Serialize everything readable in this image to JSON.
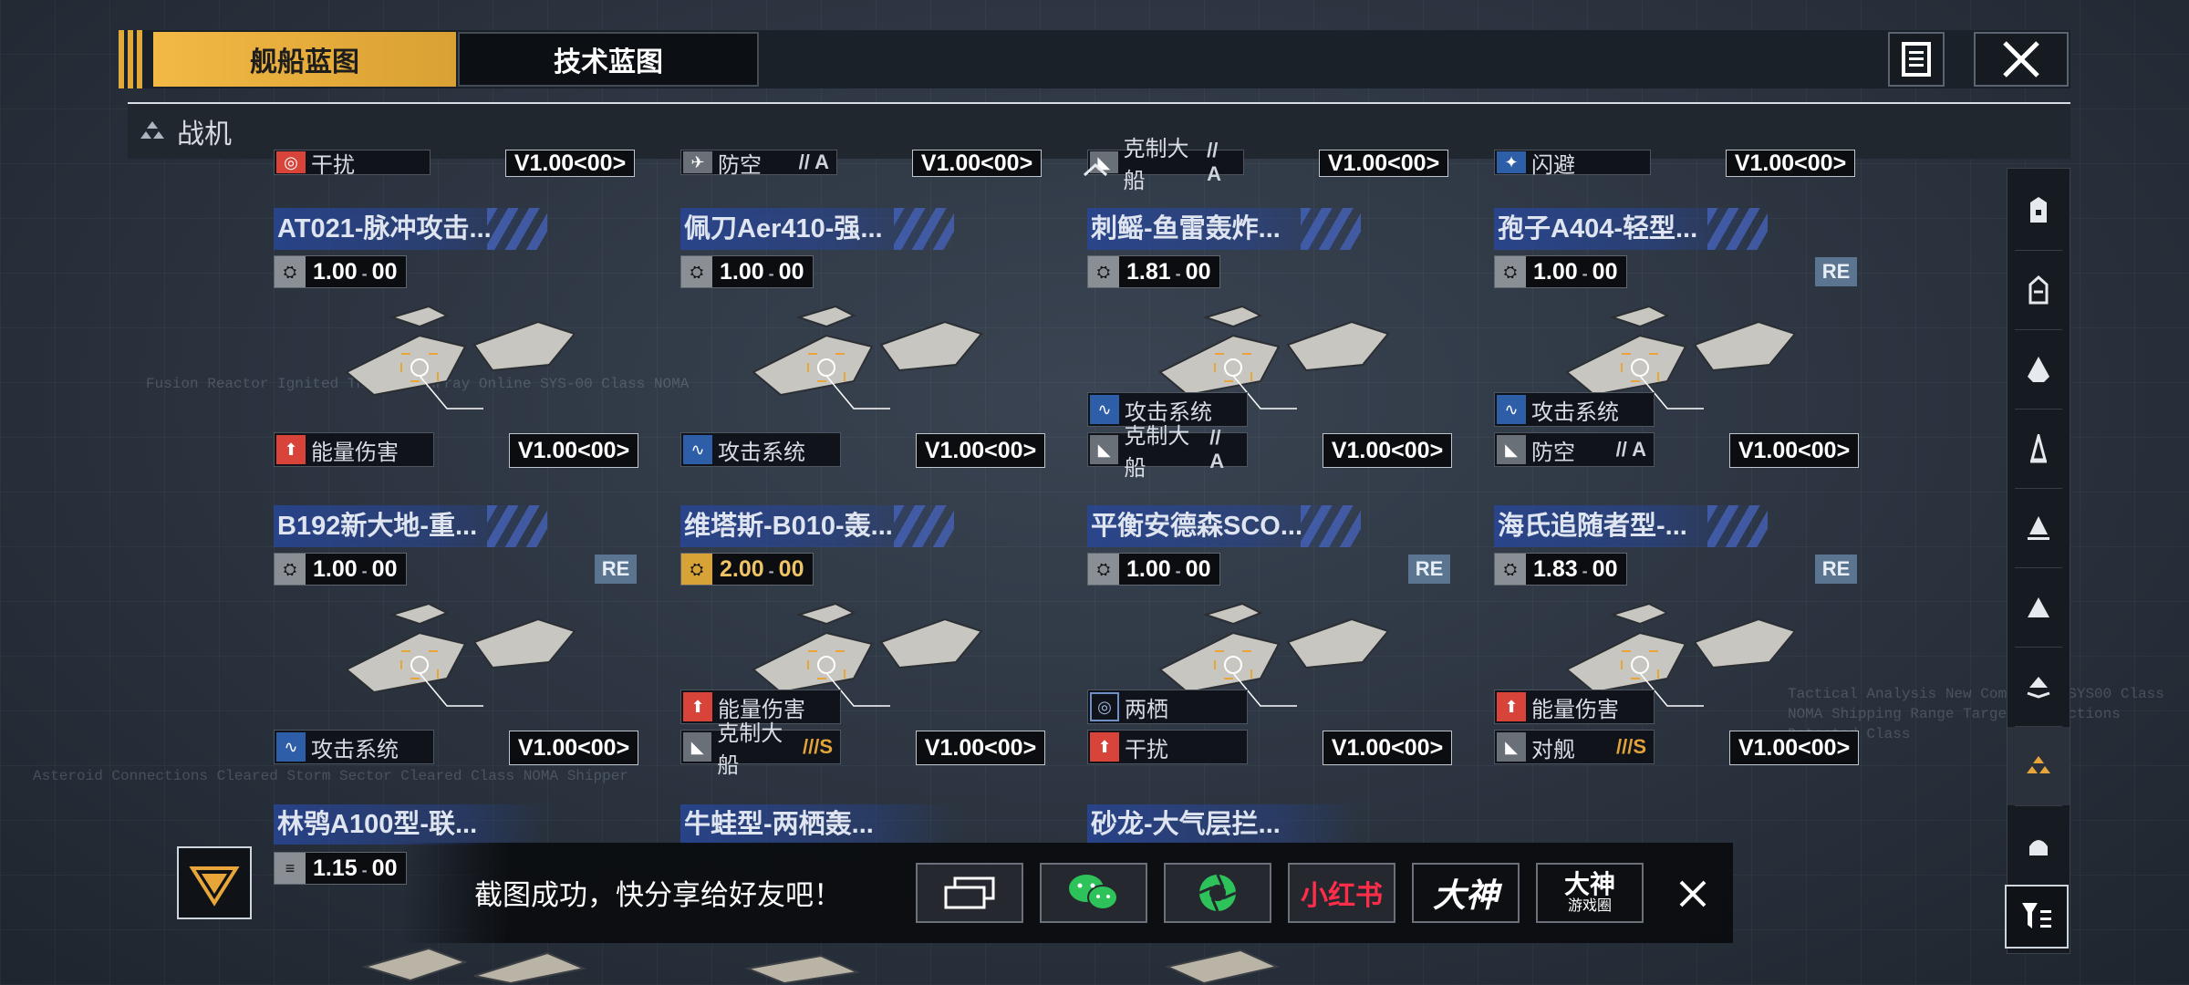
{
  "tabs": {
    "ship_blueprint": "舰船蓝图",
    "tech_blueprint": "技术蓝图"
  },
  "category": {
    "label": "战机"
  },
  "top_row_partial": [
    {
      "tag": "干扰",
      "version": "V1.00<00>"
    },
    {
      "tag": "防空",
      "rank": "// A",
      "version": "V1.00<00>"
    },
    {
      "tag": "克制大船",
      "rank": "// A",
      "version": "V1.00<00>"
    },
    {
      "tag": "闪避",
      "version": "V1.00<00>"
    }
  ],
  "cards": [
    {
      "title": "AT021-脉冲攻击...",
      "value": "1.00",
      "value_sub": "00",
      "re": false,
      "tags": [
        {
          "label": "能量伤害",
          "icon": "red"
        }
      ],
      "version": "V1.00<00>"
    },
    {
      "title": "佩刀Aer410-强...",
      "value": "1.00",
      "value_sub": "00",
      "re": false,
      "tags": [
        {
          "label": "攻击系统",
          "icon": "blue"
        }
      ],
      "version": "V1.00<00>"
    },
    {
      "title": "刺鳐-鱼雷轰炸...",
      "value": "1.81",
      "value_sub": "00",
      "re": false,
      "tags": [
        {
          "label": "攻击系统",
          "icon": "blue"
        },
        {
          "label": "克制大船",
          "icon": "grey",
          "rank": "// A"
        }
      ],
      "version": "V1.00<00>"
    },
    {
      "title": "孢子A404-轻型...",
      "value": "1.00",
      "value_sub": "00",
      "re": true,
      "re_label": "RE",
      "tags": [
        {
          "label": "攻击系统",
          "icon": "blue"
        },
        {
          "label": "防空",
          "icon": "grey",
          "rank": "// A"
        }
      ],
      "version": "V1.00<00>"
    },
    {
      "title": "B192新大地-重...",
      "value": "1.00",
      "value_sub": "00",
      "re": true,
      "re_label": "RE",
      "tags": [
        {
          "label": "攻击系统",
          "icon": "blue"
        }
      ],
      "version": "V1.00<00>"
    },
    {
      "title": "维塔斯-B010-轰...",
      "value": "2.00",
      "value_sub": "00",
      "gold": true,
      "re": false,
      "tags": [
        {
          "label": "能量伤害",
          "icon": "red"
        },
        {
          "label": "克制大船",
          "icon": "grey",
          "rank": "///S",
          "rank_gold": true
        }
      ],
      "version": "V1.00<00>"
    },
    {
      "title": "平衡安德森SCO...",
      "value": "1.00",
      "value_sub": "00",
      "re": true,
      "re_label": "RE",
      "tags": [
        {
          "label": "两栖",
          "icon": "outline"
        },
        {
          "label": "干扰",
          "icon": "red"
        }
      ],
      "version": "V1.00<00>"
    },
    {
      "title": "海氏追随者型-...",
      "value": "1.83",
      "value_sub": "00",
      "re": true,
      "re_label": "RE",
      "tags": [
        {
          "label": "能量伤害",
          "icon": "red"
        },
        {
          "label": "对舰",
          "icon": "grey",
          "rank": "///S",
          "rank_gold": true
        }
      ],
      "version": "V1.00<00>"
    }
  ],
  "bottom_row": [
    {
      "title": "林鸮A100型-联...",
      "value": "1.15",
      "value_sub": "00"
    },
    {
      "title": "牛蛙型-两栖轰..."
    },
    {
      "title": "砂龙-大气层拦..."
    }
  ],
  "share": {
    "message": "截图成功，快分享给好友吧！",
    "xiaohongshu": "小红书",
    "dashen": "大神",
    "dashen_circle_top": "大神",
    "dashen_circle_bottom": "游戏圈"
  },
  "colors": {
    "accent": "#e7a53a",
    "title_blue": "#2846a0",
    "bg": "#2a3340"
  }
}
